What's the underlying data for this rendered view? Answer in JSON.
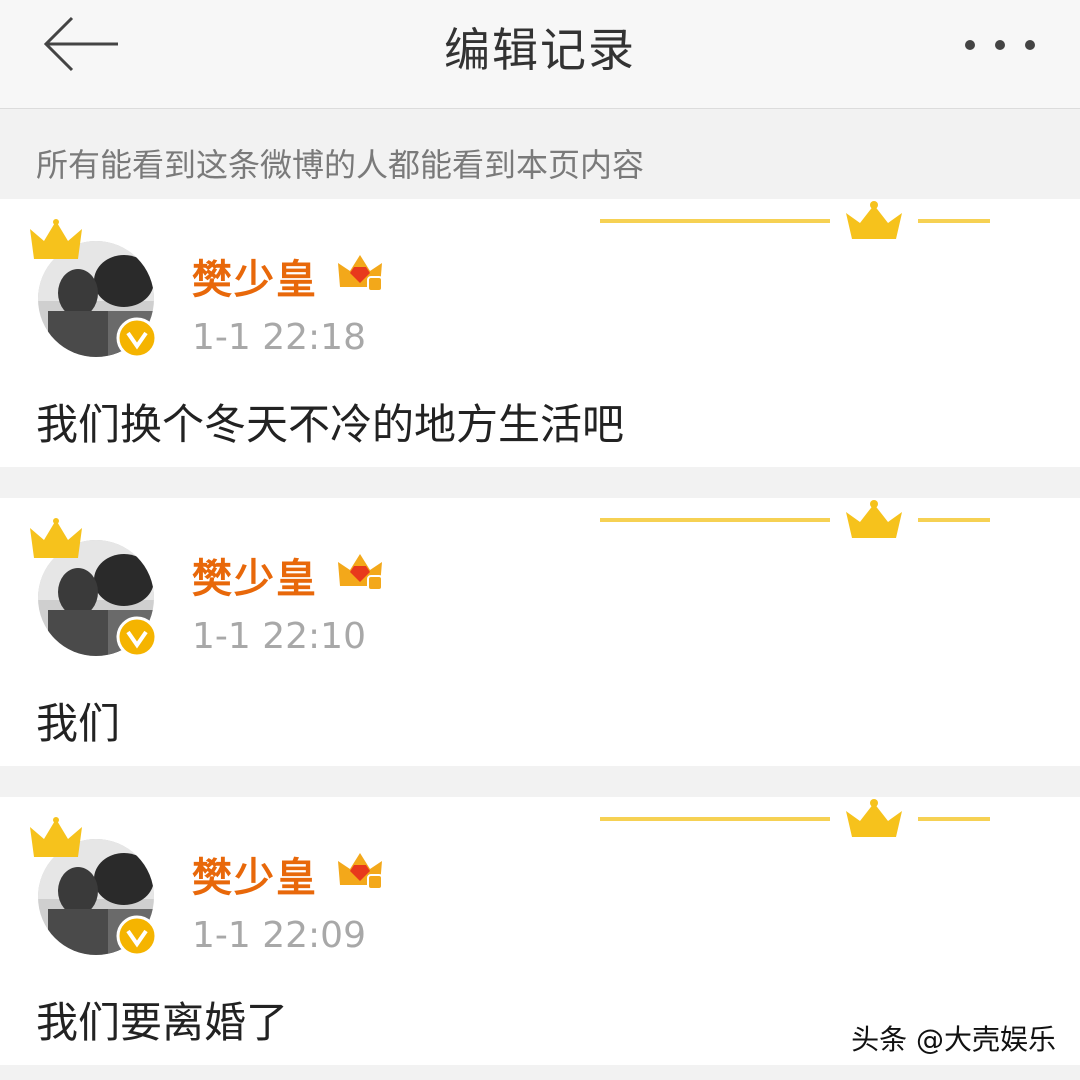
{
  "header": {
    "title": "编辑记录",
    "back_icon": "arrow-left-icon",
    "more_icon": "more-dots-icon"
  },
  "notice": "所有能看到这条微博的人都能看到本页内容",
  "colors": {
    "accent": "#e8680a",
    "gold": "#f3c21a",
    "verified": "#f5b400"
  },
  "records": [
    {
      "name": "樊少皇",
      "time": "1-1 22:18",
      "content": "我们换个冬天不冷的地方生活吧"
    },
    {
      "name": "樊少皇",
      "time": "1-1 22:10",
      "content": "我们"
    },
    {
      "name": "樊少皇",
      "time": "1-1 22:09",
      "content": "我们要离婚了"
    }
  ],
  "watermark": "头条 @大壳娱乐"
}
